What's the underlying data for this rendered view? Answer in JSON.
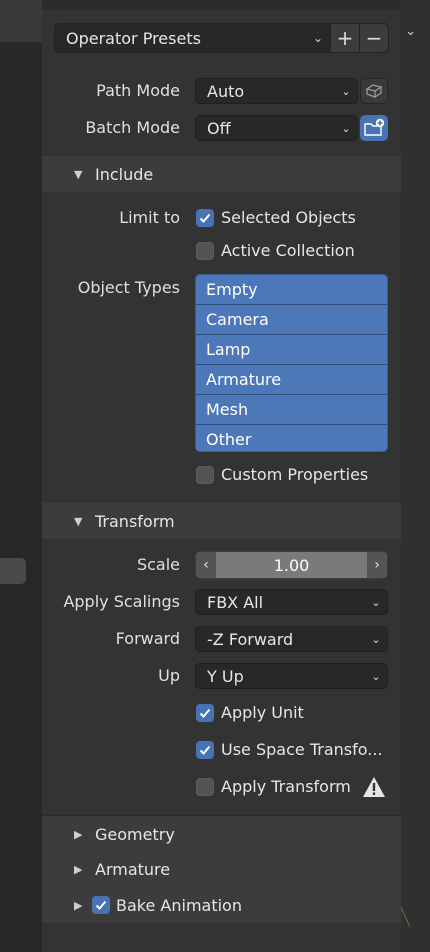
{
  "operator_presets": {
    "label": "Operator Presets",
    "add": "+",
    "remove": "−"
  },
  "path_mode": {
    "label": "Path Mode",
    "value": "Auto"
  },
  "batch_mode": {
    "label": "Batch Mode",
    "value": "Off"
  },
  "include": {
    "title": "Include",
    "limit_to_label": "Limit to",
    "selected_objects": {
      "label": "Selected Objects",
      "checked": true
    },
    "active_collection": {
      "label": "Active Collection",
      "checked": false
    },
    "object_types_label": "Object Types",
    "object_types": [
      "Empty",
      "Camera",
      "Lamp",
      "Armature",
      "Mesh",
      "Other"
    ],
    "custom_properties": {
      "label": "Custom Properties",
      "checked": false
    }
  },
  "transform": {
    "title": "Transform",
    "scale": {
      "label": "Scale",
      "value": "1.00"
    },
    "apply_scalings": {
      "label": "Apply Scalings",
      "value": "FBX All"
    },
    "forward": {
      "label": "Forward",
      "value": "-Z Forward"
    },
    "up": {
      "label": "Up",
      "value": "Y Up"
    },
    "apply_unit": {
      "label": "Apply Unit",
      "checked": true
    },
    "use_space_transform": {
      "label": "Use Space Transfo...",
      "checked": true
    },
    "apply_transform": {
      "label": "Apply Transform",
      "checked": false
    }
  },
  "geometry": {
    "title": "Geometry"
  },
  "armature": {
    "title": "Armature"
  },
  "bake_animation": {
    "title": "Bake Animation",
    "checked": true
  },
  "colors": {
    "accent": "#4772b3",
    "panel": "#333333",
    "header": "#3c3c3c"
  }
}
